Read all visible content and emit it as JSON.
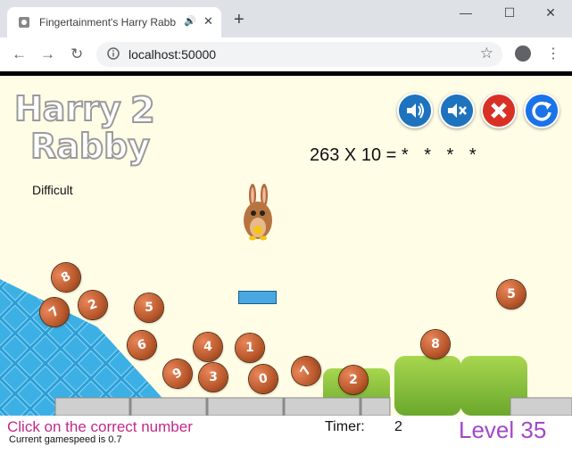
{
  "browser": {
    "tab_title": "Fingertainment's Harry Rabb",
    "tab_audio_icon": "speaker-icon",
    "url": "localhost:50000",
    "new_tab_label": "+",
    "window_controls": {
      "minimize": "—",
      "maximize": "☐",
      "close": "✕"
    }
  },
  "game": {
    "logo_text": "Harry Rabby 2",
    "question": "263 X 10 =",
    "answer_mask": "* * * *",
    "difficulty": "Difficult",
    "controls": [
      {
        "name": "sound-on-icon",
        "color": "#1e73be"
      },
      {
        "name": "sound-off-icon",
        "color": "#1e73be"
      },
      {
        "name": "quit-icon",
        "color": "#d93025"
      },
      {
        "name": "restart-icon",
        "color": "#1a73e8"
      }
    ],
    "balls": [
      "8",
      "7",
      "2",
      "5",
      "6",
      "4",
      "1",
      "9",
      "3",
      "0",
      "7",
      "2",
      "8",
      "5"
    ],
    "colors": {
      "background": "#fffde6",
      "ball": "#b8582b",
      "tiles": "#2a9fd8",
      "bushes": "#8cc63f",
      "level_text": "#a347c9",
      "instruction_text": "#c2298c"
    }
  },
  "status": {
    "instruction": "Click on the correct number",
    "speed": "Current gamespeed is 0.7",
    "timer_label": "Timer:",
    "timer_value": "2",
    "level": "Level 35"
  }
}
